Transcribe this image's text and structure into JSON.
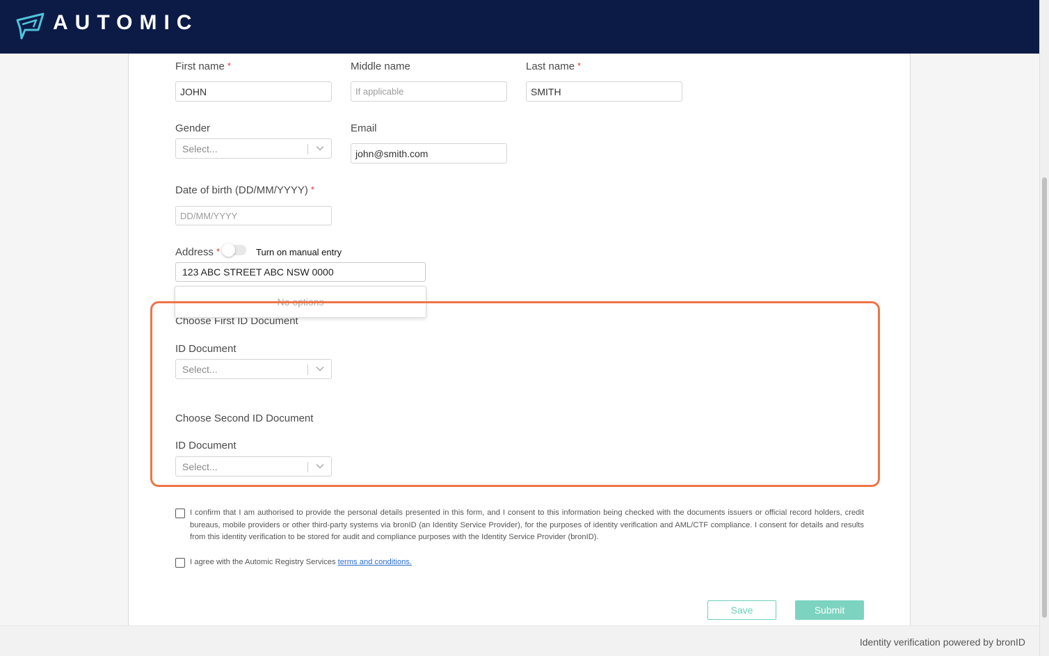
{
  "brand": {
    "name": "AUTOMIC",
    "colors": {
      "header_bg": "#0c1b46",
      "logo_accent": "#4fc3d9",
      "highlight": "#f07345",
      "primary": "#7cd3c0",
      "required": "#e5343d"
    }
  },
  "form": {
    "first_name": {
      "label": "First name",
      "required": "*",
      "value": "JOHN"
    },
    "middle_name": {
      "label": "Middle name",
      "placeholder": "If applicable"
    },
    "last_name": {
      "label": "Last name",
      "required": "*",
      "value": "SMITH"
    },
    "gender": {
      "label": "Gender",
      "placeholder": "Select..."
    },
    "email": {
      "label": "Email",
      "value": "john@smith.com"
    },
    "dob": {
      "label": "Date of birth (DD/MM/YYYY)",
      "required": "*",
      "placeholder": "DD/MM/YYYY"
    },
    "address": {
      "label": "Address",
      "required": "*",
      "manual_entry_label": "Turn on manual entry",
      "manual_entry_on": false,
      "value": "123 ABC STREET ABC NSW 0000",
      "dropdown_message": "No options"
    },
    "first_id": {
      "heading": "Choose First ID Document",
      "label": "ID Document",
      "placeholder": "Select..."
    },
    "second_id": {
      "heading": "Choose Second ID Document",
      "label": "ID Document",
      "placeholder": "Select..."
    },
    "consent_text": "I confirm that I am authorised to provide the personal details presented in this form, and I consent to this information being checked with the documents issuers or official record holders, credit bureaus, mobile providers or other third-party systems via bronID (an Identity Service Provider), for the purposes of identity verification and AML/CTF compliance. I consent for details and results from this identity verification to be stored for audit and compliance purposes with the Identity Service Provider (bronID).",
    "terms_prefix": "I agree with the Automic Registry Services",
    "terms_link": "terms and conditions.",
    "save_label": "Save",
    "submit_label": "Submit"
  },
  "footer": {
    "text": "Identity verification powered by bronID"
  },
  "icons": {
    "logo": "automic-logo-icon",
    "select_arrow": "chevron-down-icon"
  }
}
